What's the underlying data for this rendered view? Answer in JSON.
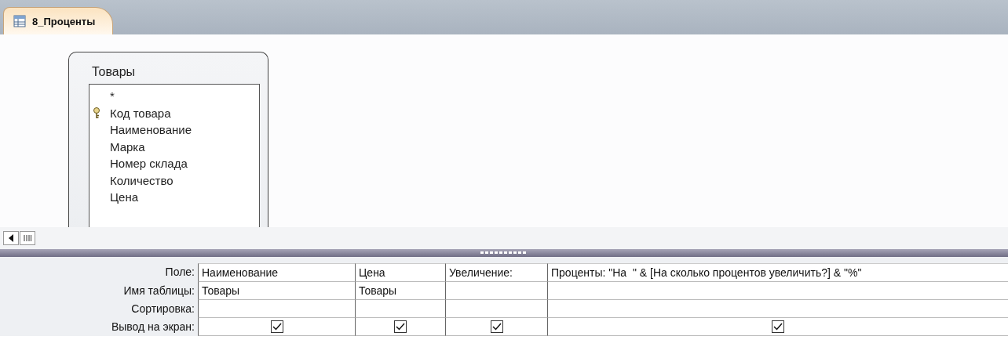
{
  "tab": {
    "label": "8_Проценты",
    "selected": true
  },
  "table_box": {
    "title": "Товары",
    "fields": [
      {
        "name": "*",
        "primary_key": false
      },
      {
        "name": "Код товара",
        "primary_key": true
      },
      {
        "name": "Наименование",
        "primary_key": false
      },
      {
        "name": "Марка",
        "primary_key": false
      },
      {
        "name": "Номер склада",
        "primary_key": false
      },
      {
        "name": "Количество",
        "primary_key": false
      },
      {
        "name": "Цена",
        "primary_key": false
      }
    ]
  },
  "grid": {
    "row_labels": [
      "Поле:",
      "Имя таблицы:",
      "Сортировка:",
      "Вывод на экран:"
    ],
    "columns": [
      {
        "field": "Наименование",
        "table": "Товары",
        "show": true
      },
      {
        "field": "Цена",
        "table": "Товары",
        "show": true
      },
      {
        "field": "Увеличение:",
        "show": true
      },
      {
        "field": "Проценты: \"На  \" & [На сколько процентов увеличить?] & \"%\"",
        "show": true
      }
    ]
  }
}
